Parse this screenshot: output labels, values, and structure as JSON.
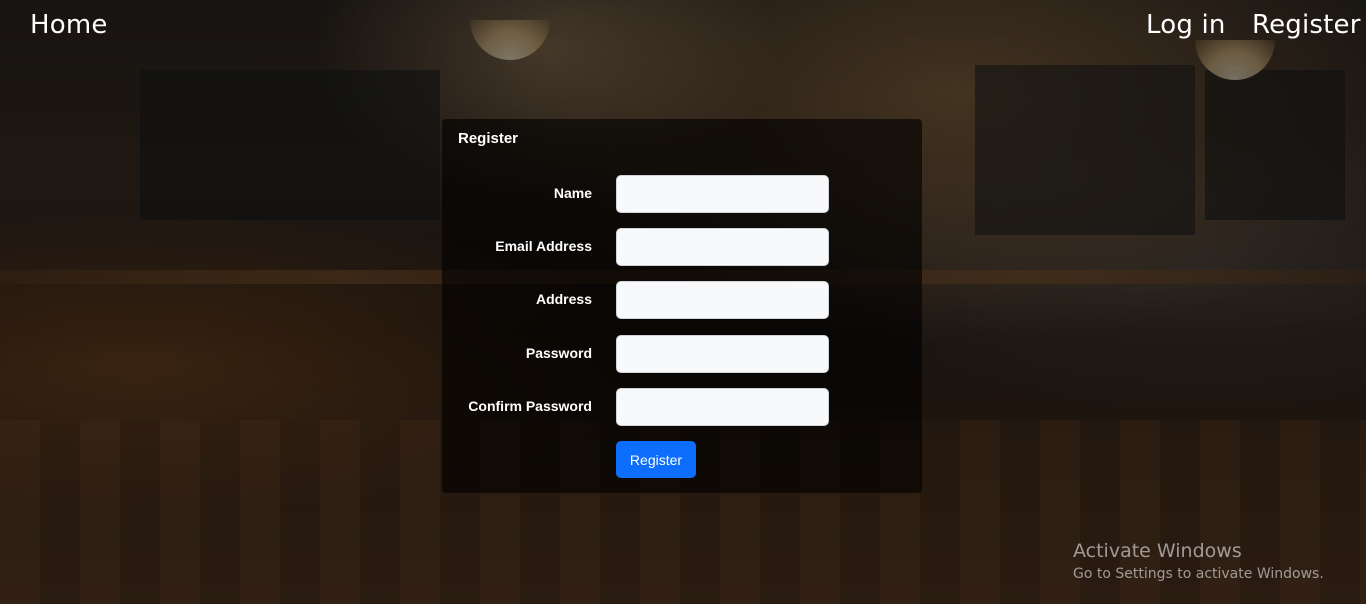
{
  "nav": {
    "home": "Home",
    "login": "Log in",
    "register": "Register"
  },
  "form": {
    "title": "Register",
    "fields": [
      {
        "label": "Name",
        "value": ""
      },
      {
        "label": "Email Address",
        "value": ""
      },
      {
        "label": "Address",
        "value": ""
      },
      {
        "label": "Password",
        "value": ""
      },
      {
        "label": "Confirm Password",
        "value": ""
      }
    ],
    "submit_label": "Register"
  },
  "watermark": {
    "title": "Activate Windows",
    "subtitle": "Go to Settings to activate Windows."
  },
  "colors": {
    "primary_button": "#0d6efd",
    "panel_background": "rgba(0,0,0,0.62)"
  }
}
